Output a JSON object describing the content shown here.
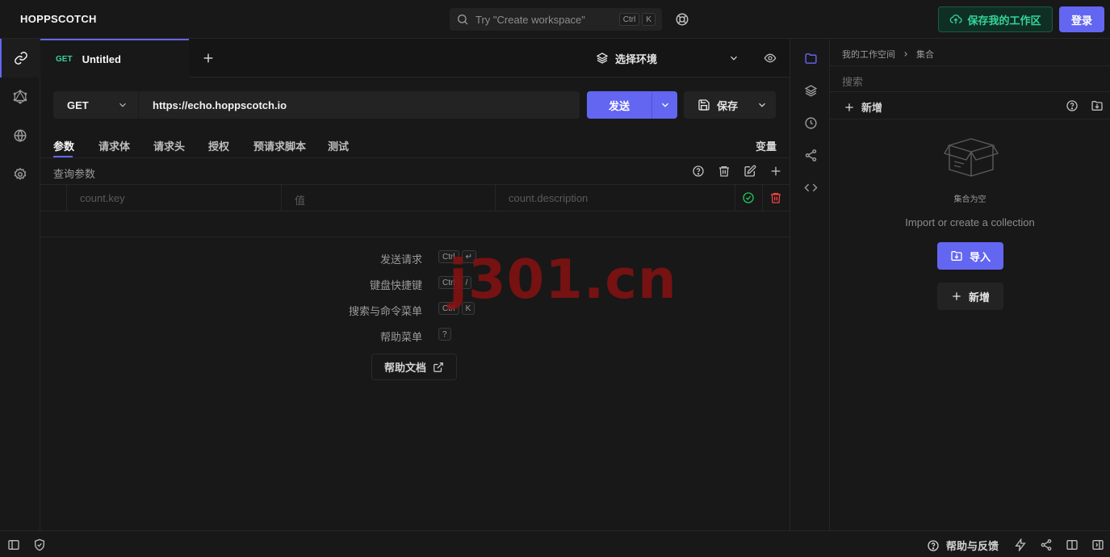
{
  "header": {
    "logo": "HOPPSCOTCH",
    "search_placeholder": "Try \"Create workspace\"",
    "search_keys": [
      "Ctrl",
      "K"
    ],
    "save_workspace_label": "保存我的工作区",
    "login_label": "登录",
    "accent_color": "#6366f1",
    "save_color": "#34d399"
  },
  "left_nav": {
    "items": [
      {
        "icon": "link-icon",
        "active": true
      },
      {
        "icon": "graphql-icon",
        "active": false
      },
      {
        "icon": "globe-icon",
        "active": false
      },
      {
        "icon": "settings-icon",
        "active": false
      }
    ]
  },
  "tabs": {
    "active": {
      "method": "GET",
      "title": "Untitled"
    },
    "env_label": "选择环境"
  },
  "request": {
    "method": "GET",
    "url": "https://echo.hoppscotch.io",
    "send_label": "发送",
    "save_label": "保存"
  },
  "sub_tabs": {
    "items": [
      "参数",
      "请求体",
      "请求头",
      "授权",
      "预请求脚本",
      "测试"
    ],
    "variables": "变量"
  },
  "params": {
    "title": "查询参数",
    "key_placeholder": "count.key",
    "value_placeholder": "值",
    "description_placeholder": "count.description"
  },
  "shortcuts": [
    {
      "label": "发送请求",
      "keys": [
        "Ctrl",
        "↵"
      ]
    },
    {
      "label": "键盘快捷键",
      "keys": [
        "Ctrl",
        "/"
      ]
    },
    {
      "label": "搜索与命令菜单",
      "keys": [
        "Ctrl",
        "K"
      ]
    },
    {
      "label": "帮助菜单",
      "keys": [
        "?"
      ]
    }
  ],
  "help_doc_label": "帮助文档",
  "watermark": "j301.cn",
  "collections": {
    "breadcrumb": [
      "我的工作空间",
      "集合"
    ],
    "search_placeholder": "搜索",
    "new_label": "新增",
    "empty_title": "集合为空",
    "empty_subtitle": "Import or create a collection",
    "import_label": "导入",
    "add_label": "新增"
  },
  "footer": {
    "help_feedback": "帮助与反馈"
  }
}
